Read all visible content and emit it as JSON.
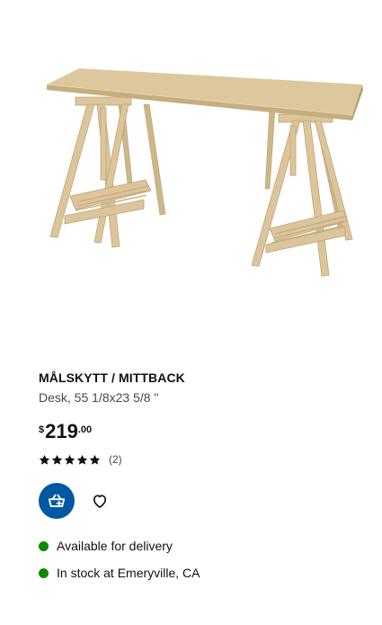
{
  "product": {
    "name": "MÅLSKYTT / MITTBACK",
    "description": "Desk, 55 1/8x23 5/8 \"",
    "price": {
      "currency": "$",
      "integer": "219",
      "decimal": ".00"
    },
    "rating": {
      "stars": 5,
      "count_text": "(2)"
    },
    "image_icon": "desk-image"
  },
  "actions": {
    "cart_icon": "add-to-cart-icon",
    "favorite_icon": "heart-icon"
  },
  "availability": [
    {
      "text": "Available for delivery",
      "status_color": "#0a8a00"
    },
    {
      "text": "In stock at Emeryville, CA",
      "status_color": "#0a8a00"
    }
  ],
  "colors": {
    "accent": "#0058a3",
    "wood": "#d9c49a"
  }
}
